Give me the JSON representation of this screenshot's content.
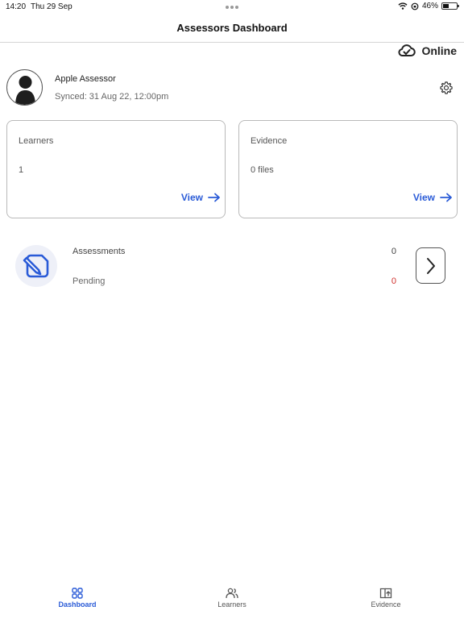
{
  "status_bar": {
    "time": "14:20",
    "date": "Thu 29 Sep",
    "battery": "46%",
    "battery_level": 0.46
  },
  "header": {
    "title": "Assessors Dashboard"
  },
  "connection": {
    "label": "Online",
    "icon": "cloud-check-icon"
  },
  "profile": {
    "name": "Apple Assessor",
    "synced": "Synced: 31 Aug 22, 12:00pm"
  },
  "cards": {
    "learners": {
      "title": "Learners",
      "value": "1",
      "view_label": "View"
    },
    "evidence": {
      "title": "Evidence",
      "value": "0 files",
      "view_label": "View"
    }
  },
  "assessments": {
    "label": "Assessments",
    "count": "0",
    "pending_label": "Pending",
    "pending_count": "0"
  },
  "tabs": [
    {
      "label": "Dashboard",
      "icon": "grid-icon",
      "active": true
    },
    {
      "label": "Learners",
      "icon": "users-icon",
      "active": false
    },
    {
      "label": "Evidence",
      "icon": "folder-upload-icon",
      "active": false
    }
  ],
  "colors": {
    "accent": "#2a5bd7",
    "pending": "#d0312d",
    "card_border": "#b9b9b9"
  }
}
